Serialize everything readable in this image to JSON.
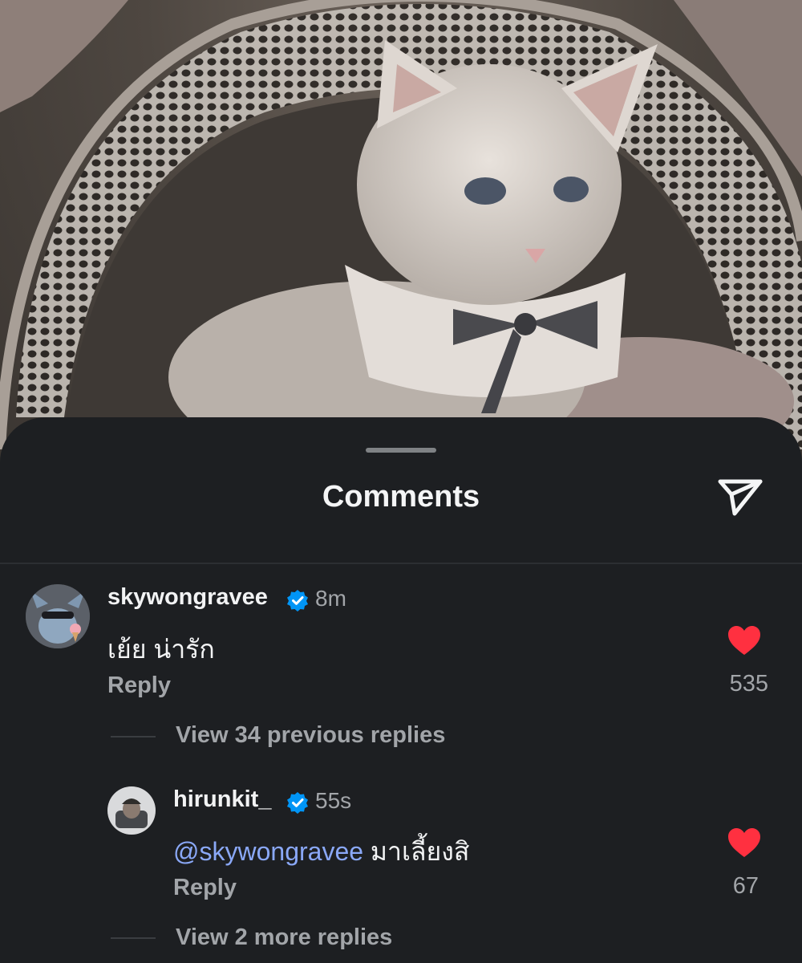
{
  "sheet": {
    "title": "Comments",
    "share_icon": "paper-plane-icon"
  },
  "comments": [
    {
      "username": "skywongravee",
      "verified": true,
      "time": "8m",
      "text": "เย้ย น่ารัก",
      "reply_label": "Reply",
      "likes": "535",
      "liked": true,
      "view_replies_label": "View 34 previous replies"
    }
  ],
  "replies": [
    {
      "username": "hirunkit_",
      "verified": true,
      "time": "55s",
      "mention": "@skywongravee",
      "text": "มาเลี้ยงสิ",
      "reply_label": "Reply",
      "likes": "67",
      "liked": true,
      "view_more_label": "View 2 more replies"
    }
  ],
  "colors": {
    "heart": "#ff3040",
    "verified": "#0095f6",
    "mention": "#8aa8f7",
    "sheet_bg": "#1d1f22"
  }
}
